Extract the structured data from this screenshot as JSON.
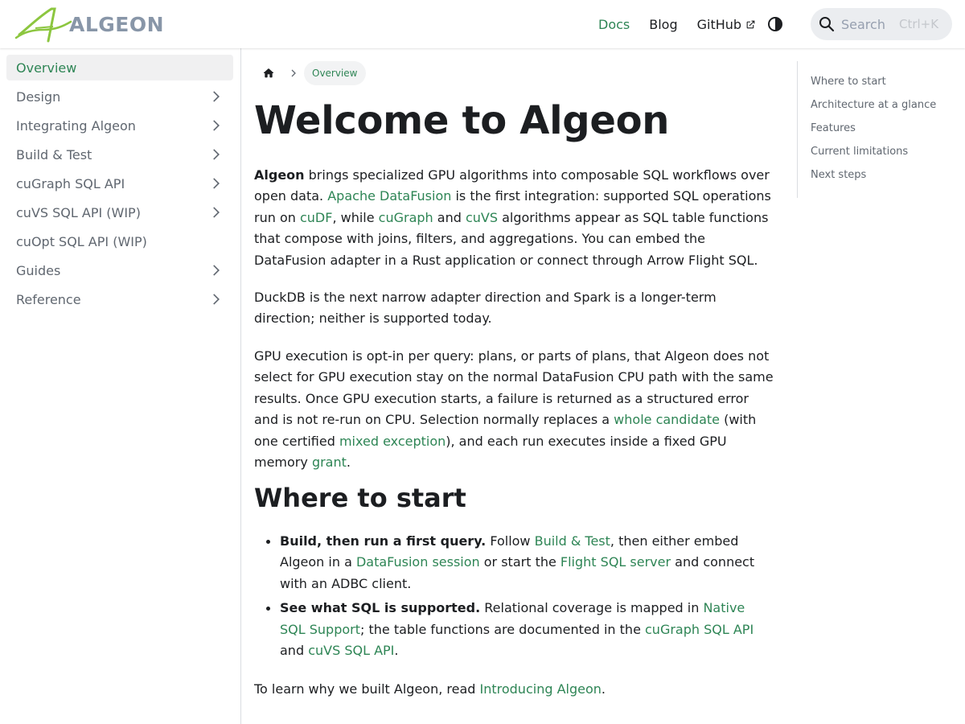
{
  "brand": {
    "name": "ALGEON",
    "mark": "A"
  },
  "nav": {
    "docs": "Docs",
    "blog": "Blog",
    "github": "GitHub",
    "search_placeholder": "Search",
    "search_shortcut": "Ctrl+K"
  },
  "sidebar": {
    "items": [
      {
        "label": "Overview",
        "active": true,
        "expandable": false
      },
      {
        "label": "Design",
        "expandable": true
      },
      {
        "label": "Integrating Algeon",
        "expandable": true
      },
      {
        "label": "Build & Test",
        "expandable": true
      },
      {
        "label": "cuGraph SQL API",
        "expandable": true
      },
      {
        "label": "cuVS SQL API (WIP)",
        "expandable": true
      },
      {
        "label": "cuOpt SQL API (WIP)",
        "expandable": false
      },
      {
        "label": "Guides",
        "expandable": true
      },
      {
        "label": "Reference",
        "expandable": true
      }
    ]
  },
  "breadcrumb": {
    "current": "Overview"
  },
  "page": {
    "title": "Welcome to Algeon",
    "p1": {
      "bold": "Algeon",
      "t1": " brings specialized GPU algorithms into composable SQL workflows over open data. ",
      "link1": "Apache DataFusion",
      "t2": " is the first integration: supported SQL operations run on ",
      "link2": "cuDF",
      "t3": ", while ",
      "link3": "cuGraph",
      "t4": " and ",
      "link4": "cuVS",
      "t5": " algorithms appear as SQL table functions that compose with joins, filters, and aggregations. You can embed the DataFusion adapter in a Rust application or connect through Arrow Flight SQL."
    },
    "p2": "DuckDB is the next narrow adapter direction and Spark is a longer-term direction; neither is supported today.",
    "p3": {
      "t1": "GPU execution is opt-in per query: plans, or parts of plans, that Algeon does not select for GPU execution stay on the normal DataFusion CPU path with the same results. Once GPU execution starts, a failure is returned as a structured error and is not re-run on CPU. Selection normally replaces a ",
      "link1": "whole candidate",
      "t2": " (with one certified ",
      "link2": "mixed exception",
      "t3": "), and each run executes inside a fixed GPU memory ",
      "link3": "grant",
      "t4": "."
    },
    "section_title": "Where to start",
    "bullet1": {
      "bold": "Build, then run a first query.",
      "t1": " Follow ",
      "link1": "Build & Test",
      "t2": ", then either embed Algeon in a ",
      "link2": "DataFusion session",
      "t3": " or start the ",
      "link3": "Flight SQL server",
      "t4": " and connect with an ADBC client."
    },
    "bullet2": {
      "bold": "See what SQL is supported.",
      "t1": " Relational coverage is mapped in ",
      "link1": "Native SQL Support",
      "t2": "; the table functions are documented in the ",
      "link2": "cuGraph SQL API",
      "t3": " and ",
      "link3": "cuVS SQL API",
      "t4": "."
    },
    "p4": {
      "t1": "To learn why we built Algeon, read ",
      "link1": "Introducing Algeon",
      "t2": "."
    }
  },
  "toc": {
    "items": [
      "Where to start",
      "Architecture at a glance",
      "Features",
      "Current limitations",
      "Next steps"
    ]
  },
  "colors": {
    "accent": "#2e8555",
    "logo_green": "#8cc63f",
    "logo_gray": "#8896a8",
    "text": "#1c1e21",
    "muted": "#606770"
  }
}
